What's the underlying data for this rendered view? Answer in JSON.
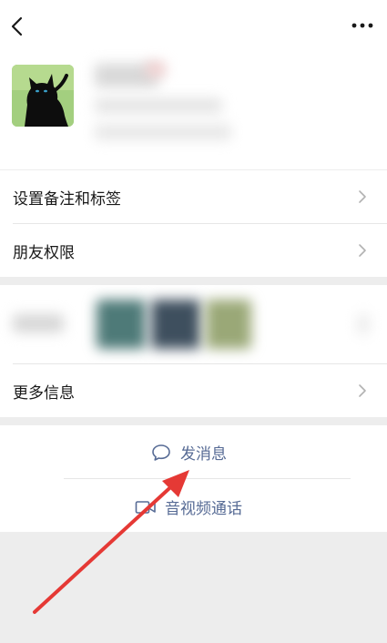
{
  "profile": {
    "settings_remark_tags": "设置备注和标签",
    "friend_permissions": "朋友权限",
    "more_info": "更多信息"
  },
  "actions": {
    "send_message": "发消息",
    "video_call": "音视频通话"
  },
  "colors": {
    "page_background": "#ededed",
    "card_background": "#ffffff",
    "link_text": "#576b95",
    "annotation_arrow": "#e53935"
  },
  "icons": {
    "back": "chevron-left-icon",
    "more": "more-dots-icon",
    "row_arrow": "chevron-right-icon",
    "message": "chat-bubble-icon",
    "video": "video-camera-icon"
  }
}
